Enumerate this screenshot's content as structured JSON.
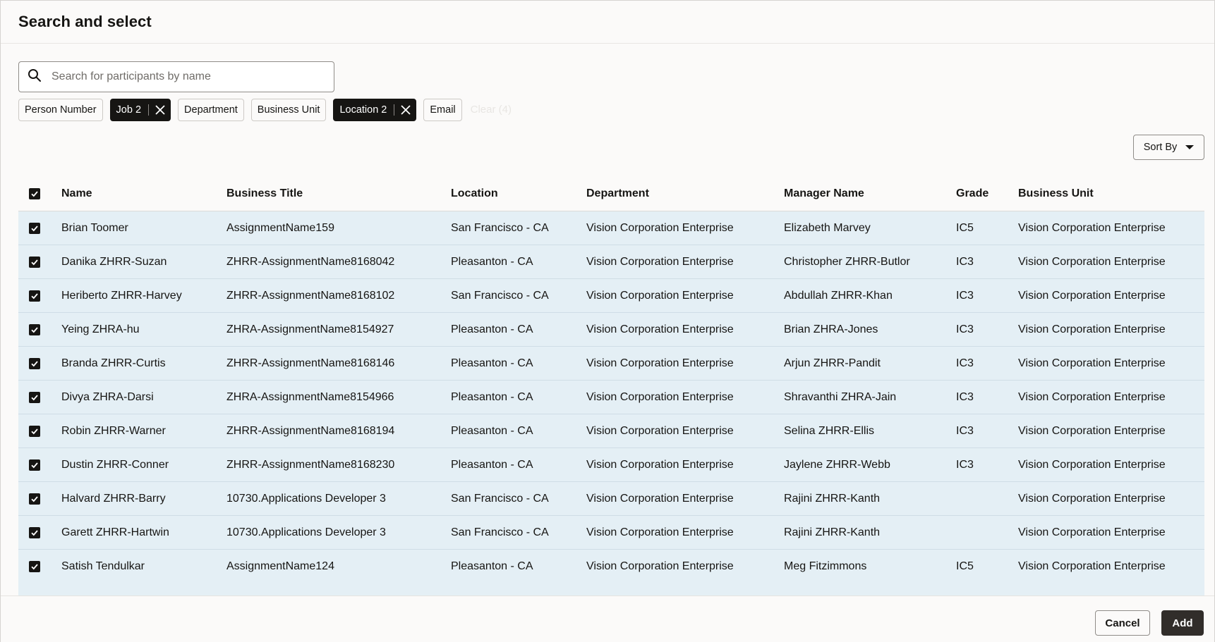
{
  "dialog": {
    "title": "Search and select"
  },
  "search": {
    "placeholder": "Search for participants by name",
    "value": ""
  },
  "filters": {
    "chips": [
      {
        "label": "Person Number",
        "active": false
      },
      {
        "label": "Job 2",
        "active": true
      },
      {
        "label": "Department",
        "active": false
      },
      {
        "label": "Business Unit",
        "active": false
      },
      {
        "label": "Location 2",
        "active": true
      },
      {
        "label": "Email",
        "active": false
      }
    ],
    "clear_label": "Clear (4)"
  },
  "sort": {
    "label": "Sort By"
  },
  "table": {
    "columns": [
      "Name",
      "Business Title",
      "Location",
      "Department",
      "Manager Name",
      "Grade",
      "Business Unit"
    ],
    "select_all_checked": true,
    "rows": [
      {
        "checked": true,
        "cells": [
          "Brian Toomer",
          "AssignmentName159",
          "San Francisco - CA",
          "Vision Corporation Enterprise",
          "Elizabeth Marvey",
          "IC5",
          "Vision Corporation Enterprise"
        ]
      },
      {
        "checked": true,
        "cells": [
          "Danika ZHRR-Suzan",
          "ZHRR-AssignmentName8168042",
          "Pleasanton - CA",
          "Vision Corporation Enterprise",
          "Christopher ZHRR-Butlor",
          "IC3",
          "Vision Corporation Enterprise"
        ]
      },
      {
        "checked": true,
        "cells": [
          "Heriberto ZHRR-Harvey",
          "ZHRR-AssignmentName8168102",
          "San Francisco - CA",
          "Vision Corporation Enterprise",
          "Abdullah ZHRR-Khan",
          "IC3",
          "Vision Corporation Enterprise"
        ]
      },
      {
        "checked": true,
        "cells": [
          "Yeing ZHRA-hu",
          "ZHRA-AssignmentName8154927",
          "Pleasanton - CA",
          "Vision Corporation Enterprise",
          "Brian ZHRA-Jones",
          "IC3",
          "Vision Corporation Enterprise"
        ]
      },
      {
        "checked": true,
        "cells": [
          "Branda ZHRR-Curtis",
          "ZHRR-AssignmentName8168146",
          "Pleasanton - CA",
          "Vision Corporation Enterprise",
          "Arjun ZHRR-Pandit",
          "IC3",
          "Vision Corporation Enterprise"
        ]
      },
      {
        "checked": true,
        "cells": [
          "Divya ZHRA-Darsi",
          "ZHRA-AssignmentName8154966",
          "Pleasanton - CA",
          "Vision Corporation Enterprise",
          "Shravanthi ZHRA-Jain",
          "IC3",
          "Vision Corporation Enterprise"
        ]
      },
      {
        "checked": true,
        "cells": [
          "Robin ZHRR-Warner",
          "ZHRR-AssignmentName8168194",
          "Pleasanton - CA",
          "Vision Corporation Enterprise",
          "Selina ZHRR-Ellis",
          "IC3",
          "Vision Corporation Enterprise"
        ]
      },
      {
        "checked": true,
        "cells": [
          "Dustin ZHRR-Conner",
          "ZHRR-AssignmentName8168230",
          "Pleasanton - CA",
          "Vision Corporation Enterprise",
          "Jaylene ZHRR-Webb",
          "IC3",
          "Vision Corporation Enterprise"
        ]
      },
      {
        "checked": true,
        "cells": [
          "Halvard ZHRR-Barry",
          "10730.Applications Developer 3",
          "San Francisco - CA",
          "Vision Corporation Enterprise",
          "Rajini ZHRR-Kanth",
          "",
          "Vision Corporation Enterprise"
        ]
      },
      {
        "checked": true,
        "cells": [
          "Garett ZHRR-Hartwin",
          "10730.Applications Developer 3",
          "San Francisco - CA",
          "Vision Corporation Enterprise",
          "Rajini ZHRR-Kanth",
          "",
          "Vision Corporation Enterprise"
        ]
      },
      {
        "checked": true,
        "cells": [
          "Satish Tendulkar",
          "AssignmentName124",
          "Pleasanton - CA",
          "Vision Corporation Enterprise",
          "Meg Fitzimmons",
          "IC5",
          "Vision Corporation Enterprise"
        ]
      }
    ]
  },
  "footer": {
    "cancel_label": "Cancel",
    "add_label": "Add"
  },
  "icons": {
    "search": "search-icon",
    "remove": "close-icon",
    "check": "checkmark-icon",
    "caret": "caret-down-icon"
  },
  "colors": {
    "row_highlight": "#e4eff5",
    "chip_active": "#161513",
    "primary_button": "#312d2a"
  }
}
